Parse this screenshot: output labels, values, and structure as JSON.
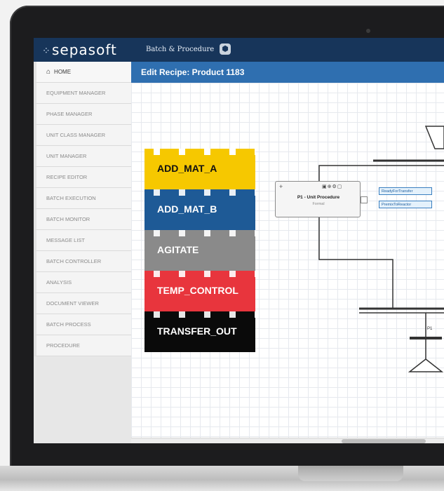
{
  "app": {
    "brand": "sepasoft",
    "title": "Batch & Procedure"
  },
  "sidebar": {
    "items": [
      {
        "label": "HOME",
        "icon": "home-icon"
      },
      {
        "label": "EQUIPMENT MANAGER"
      },
      {
        "label": "PHASE MANAGER"
      },
      {
        "label": "UNIT CLASS MANAGER"
      },
      {
        "label": "UNIT MANAGER"
      },
      {
        "label": "RECIPE EDITOR"
      },
      {
        "label": "BATCH EXECUTION"
      },
      {
        "label": "BATCH MONITOR"
      },
      {
        "label": "MESSAGE LIST"
      },
      {
        "label": "BATCH CONTROLLER"
      },
      {
        "label": "ANALYSIS"
      },
      {
        "label": "DOCUMENT VIEWER"
      },
      {
        "label": "BATCH PROCESS"
      },
      {
        "label": "PROCEDURE"
      }
    ]
  },
  "header": {
    "title": "Edit Recipe: Product 1183"
  },
  "blocks": [
    {
      "label": "ADD_MAT_A",
      "color": "#f6c800",
      "text_color": "#111111"
    },
    {
      "label": "ADD_MAT_B",
      "color": "#1e5a96",
      "text_color": "#ffffff"
    },
    {
      "label": "AGITATE",
      "color": "#8a8a8a",
      "text_color": "#ffffff"
    },
    {
      "label": "TEMP_CONTROL",
      "color": "#e8353d",
      "text_color": "#ffffff"
    },
    {
      "label": "TRANSFER_OUT",
      "color": "#0a0a0a",
      "text_color": "#ffffff"
    }
  ],
  "diagram": {
    "unit_procedure": {
      "name": "P1 - Unit Procedure",
      "sub": "Formal"
    },
    "tags": [
      "ReadyForTransfer",
      "PremixToReactor"
    ],
    "step_label": "P1"
  },
  "colors": {
    "topbar": "#17355a",
    "header": "#2f6fb0",
    "bezel": "#1c1c1e"
  }
}
